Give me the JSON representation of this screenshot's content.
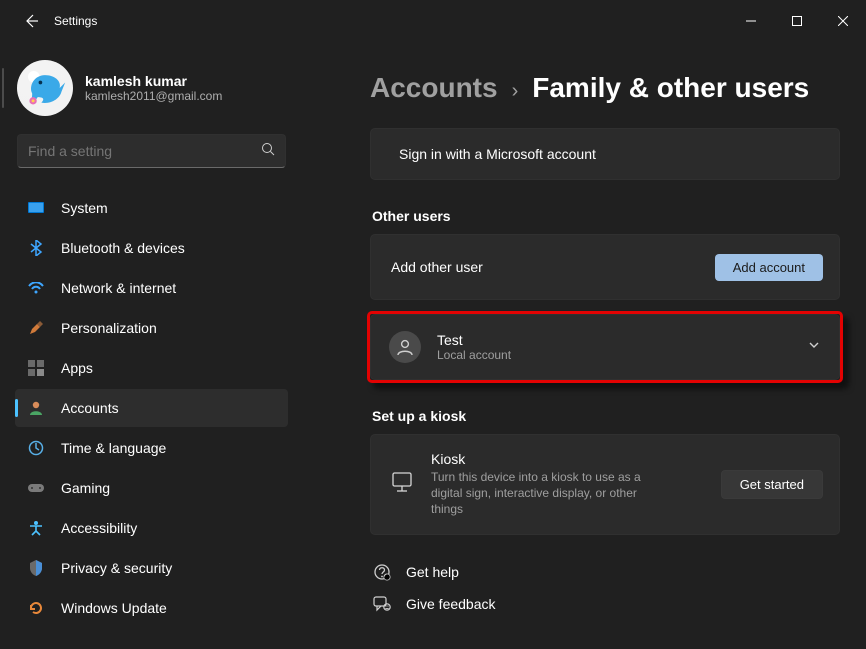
{
  "window": {
    "title": "Settings"
  },
  "user": {
    "name": "kamlesh kumar",
    "email": "kamlesh2011@gmail.com"
  },
  "search": {
    "placeholder": "Find a setting"
  },
  "nav": {
    "system": "System",
    "bluetooth": "Bluetooth & devices",
    "network": "Network & internet",
    "personalization": "Personalization",
    "apps": "Apps",
    "accounts": "Accounts",
    "time": "Time & language",
    "gaming": "Gaming",
    "accessibility": "Accessibility",
    "privacy": "Privacy & security",
    "update": "Windows Update"
  },
  "breadcrumb": {
    "parent": "Accounts",
    "current": "Family & other users"
  },
  "signin": {
    "label": "Sign in with a Microsoft account"
  },
  "other_users": {
    "heading": "Other users",
    "add_label": "Add other user",
    "add_button": "Add account",
    "entry": {
      "name": "Test",
      "type": "Local account"
    }
  },
  "kiosk": {
    "heading": "Set up a kiosk",
    "title": "Kiosk",
    "desc": "Turn this device into a kiosk to use as a digital sign, interactive display, or other things",
    "button": "Get started"
  },
  "links": {
    "help": "Get help",
    "feedback": "Give feedback"
  }
}
